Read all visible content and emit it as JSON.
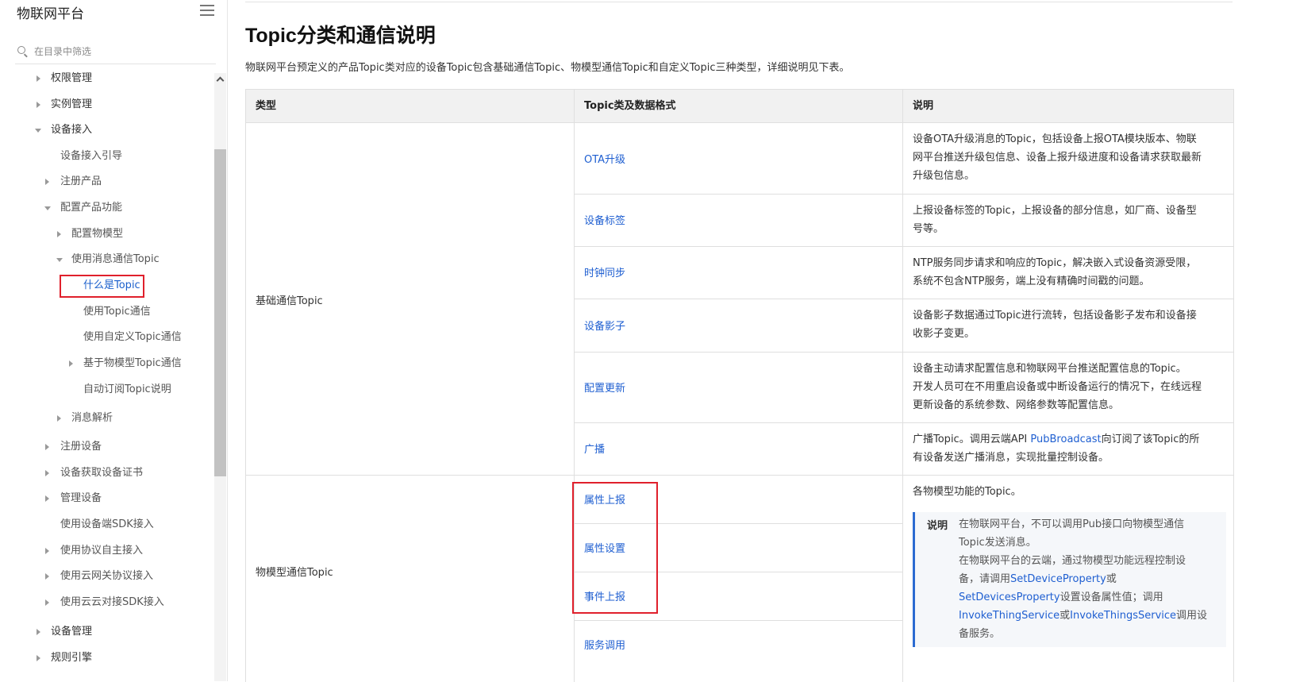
{
  "sidebar": {
    "title": "物联网平台",
    "filter_placeholder": "在目录中筛选",
    "items": [
      {
        "label": "权限管理"
      },
      {
        "label": "实例管理"
      },
      {
        "label": "设备接入"
      },
      {
        "label": "设备接入引导"
      },
      {
        "label": "注册产品"
      },
      {
        "label": "配置产品功能"
      },
      {
        "label": "配置物模型"
      },
      {
        "label": "使用消息通信Topic"
      },
      {
        "label": "什么是Topic"
      },
      {
        "label": "使用Topic通信"
      },
      {
        "label": "使用自定义Topic通信"
      },
      {
        "label": "基于物模型Topic通信"
      },
      {
        "label": "自动订阅Topic说明"
      },
      {
        "label": "消息解析"
      },
      {
        "label": "注册设备"
      },
      {
        "label": "设备获取设备证书"
      },
      {
        "label": "管理设备"
      },
      {
        "label": "使用设备端SDK接入"
      },
      {
        "label": "使用协议自主接入"
      },
      {
        "label": "使用云网关协议接入"
      },
      {
        "label": "使用云云对接SDK接入"
      },
      {
        "label": "设备管理"
      },
      {
        "label": "规则引擎"
      }
    ]
  },
  "main": {
    "title": "Topic分类和通信说明",
    "intro": "物联网平台预定义的产品Topic类对应的设备Topic包含基础通信Topic、物模型通信Topic和自定义Topic三种类型，详细说明见下表。",
    "table": {
      "headers": [
        "类型",
        "Topic类及数据格式",
        "说明"
      ],
      "groups": [
        {
          "type": "基础通信Topic",
          "rows": [
            {
              "topic": "OTA升级",
              "desc": [
                "设备OTA升级消息的Topic，包括设备上报OTA模块版本、物联",
                "网平台推送升级包信息、设备上报升级进度和设备请求获取最新",
                "升级包信息。"
              ]
            },
            {
              "topic": "设备标签",
              "desc": [
                "上报设备标签的Topic，上报设备的部分信息，如厂商、设备型",
                "号等。"
              ]
            },
            {
              "topic": "时钟同步",
              "desc": [
                "NTP服务同步请求和响应的Topic，解决嵌入式设备资源受限，",
                "系统不包含NTP服务，端上没有精确时间戳的问题。"
              ]
            },
            {
              "topic": "设备影子",
              "desc": [
                "设备影子数据通过Topic进行流转，包括设备影子发布和设备接",
                "收影子变更。"
              ]
            },
            {
              "topic": "配置更新",
              "desc": [
                "设备主动请求配置信息和物联网平台推送配置信息的Topic。",
                "开发人员可在不用重启设备或中断设备运行的情况下，在线远程",
                "更新设备的系统参数、网络参数等配置信息。"
              ]
            },
            {
              "topic": "广播",
              "desc_pre": "广播Topic。调用云端API ",
              "desc_link": "PubBroadcast",
              "desc_post": "向订阅了该Topic的所",
              "desc2": "有设备发送广播消息，实现批量控制设备。"
            }
          ]
        },
        {
          "type": "物模型通信Topic",
          "rows": [
            {
              "topic": "属性上报"
            },
            {
              "topic": "属性设置"
            },
            {
              "topic": "事件上报"
            },
            {
              "topic": "服务调用"
            }
          ],
          "desc": "各物模型功能的Topic。",
          "note": {
            "label": "说明",
            "line1": "在物联网平台，不可以调用Pub接口向物模型通信",
            "line2": "Topic发送消息。",
            "line3": "在物联网平台的云端，通过物模型功能远程控制设",
            "line4_pre": "备，请调用",
            "link1": "SetDeviceProperty",
            "line4_post": "或",
            "link2": "SetDevicesProperty",
            "line5_post": "设置设备属性值；调用",
            "link3": "InvokeThingService",
            "line6_mid": "或",
            "link4": "InvokeThingsService",
            "line6_post": "调用设",
            "line7": "备服务。"
          }
        }
      ]
    }
  },
  "colors": {
    "link": "#1f5fd1",
    "highlight_box": "#e0202c",
    "note_border": "#2b6bd1"
  }
}
